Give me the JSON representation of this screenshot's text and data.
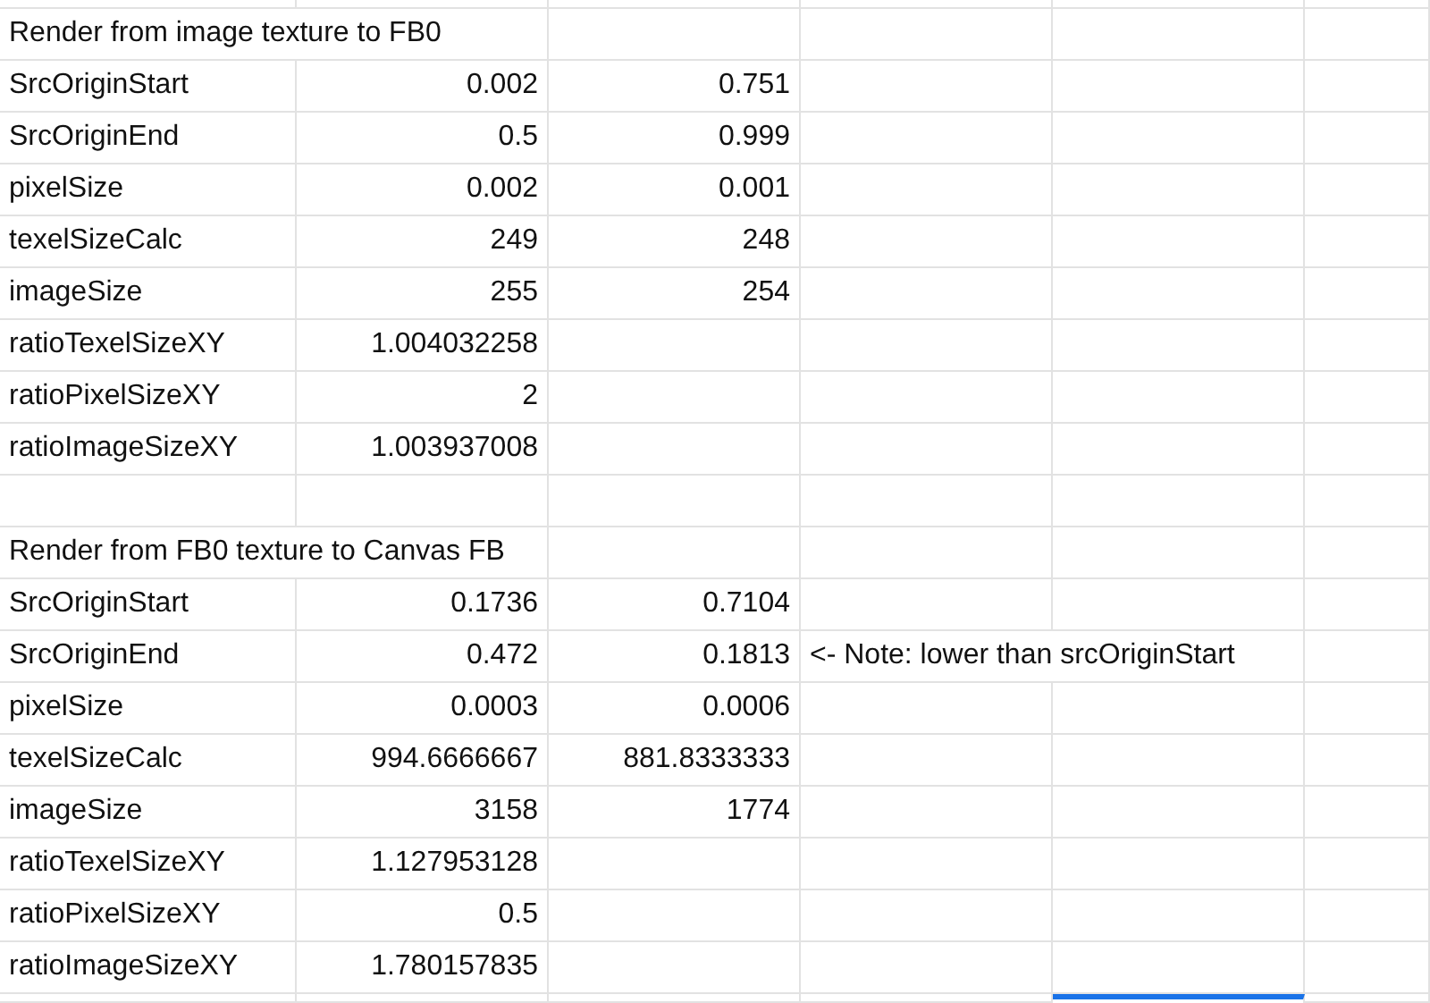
{
  "sections": [
    {
      "title": "Render from image texture to FB0",
      "rows": [
        {
          "label": "SrcOriginStart",
          "value_1": "0.002",
          "value_2": "0.751"
        },
        {
          "label": "SrcOriginEnd",
          "value_1": "0.5",
          "value_2": "0.999"
        },
        {
          "label": "pixelSize",
          "value_1": "0.002",
          "value_2": "0.001"
        },
        {
          "label": "texelSizeCalc",
          "value_1": "249",
          "value_2": "248"
        },
        {
          "label": "imageSize",
          "value_1": "255",
          "value_2": "254"
        },
        {
          "label": "ratioTexelSizeXY",
          "value_1": "1.004032258"
        },
        {
          "label": "ratioPixelSizeXY",
          "value_1": "2"
        },
        {
          "label": "ratioImageSizeXY",
          "value_1": "1.003937008"
        }
      ]
    },
    {
      "title": "Render from FB0 texture to Canvas FB",
      "rows": [
        {
          "label": "SrcOriginStart",
          "value_1": "0.1736",
          "value_2": "0.7104"
        },
        {
          "label": "SrcOriginEnd",
          "value_1": "0.472",
          "value_2": "0.1813",
          "note": "<- Note: lower than srcOriginStart"
        },
        {
          "label": "pixelSize",
          "value_1": "0.0003",
          "value_2": "0.0006"
        },
        {
          "label": "texelSizeCalc",
          "value_1": "994.6666667",
          "value_2": "881.8333333"
        },
        {
          "label": "imageSize",
          "value_1": "3158",
          "value_2": "1774"
        },
        {
          "label": "ratioTexelSizeXY",
          "value_1": "1.127953128"
        },
        {
          "label": "ratioPixelSizeXY",
          "value_1": "0.5"
        },
        {
          "label": "ratioImageSizeXY",
          "value_1": "1.780157835"
        }
      ]
    }
  ]
}
